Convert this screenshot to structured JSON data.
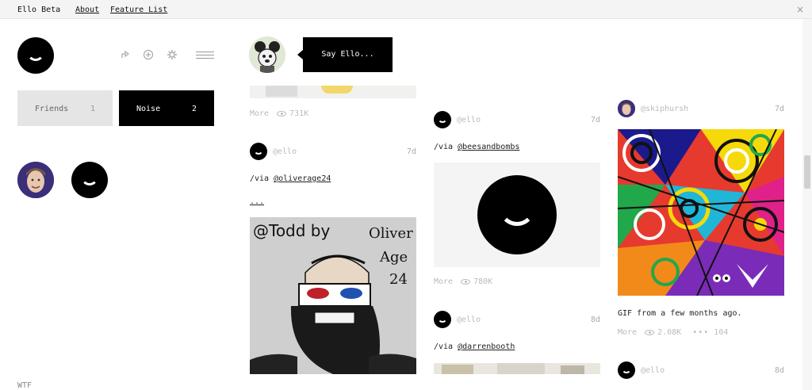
{
  "topbar": {
    "brand": "Ello Beta",
    "about": "About",
    "feature_list": "Feature List",
    "close_glyph": "×"
  },
  "sidebar": {
    "tabs": [
      {
        "label": "Friends",
        "count": "1"
      },
      {
        "label": "Noise",
        "count": "2"
      }
    ],
    "footer": "WTF",
    "icons": [
      "share-icon",
      "add-icon",
      "settings-icon",
      "menu-icon"
    ]
  },
  "composer": {
    "prompt": "Say Ello..."
  },
  "posts": {
    "top": {
      "more": "More",
      "views": "731K"
    },
    "col1": {
      "username": "@ello",
      "ago": "7d",
      "via": "/via ",
      "mention": "@oliverage24",
      "ellipsis": "...",
      "drawing_caption": "@Todd  by",
      "drawing_name": "Oliver Age 24"
    },
    "col2a": {
      "username": "@ello",
      "ago": "7d",
      "via": "/via ",
      "mention": "@beesandbombs",
      "more": "More",
      "views": "780K"
    },
    "col2b": {
      "username": "@ello",
      "ago": "8d",
      "via": "/via ",
      "mention": "@darrenbooth"
    },
    "col3a": {
      "username": "@skiphursh",
      "ago": "7d",
      "caption": "GIF from a few months ago.",
      "more": "More",
      "views": "2.08K",
      "comments": "104"
    },
    "col3b": {
      "username": "@ello",
      "ago": "8d"
    }
  },
  "colors": {
    "black": "#000000",
    "tab_inactive": "#e5e5e5",
    "muted_text": "#bbbbbb"
  }
}
